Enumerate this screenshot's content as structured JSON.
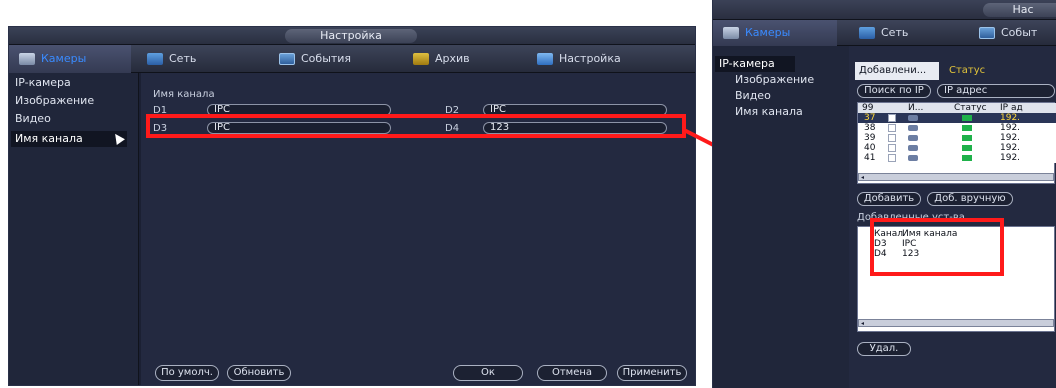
{
  "left": {
    "title": "Настройка",
    "menu": [
      {
        "label": "Камеры",
        "icon": "camera-icon"
      },
      {
        "label": "Сеть",
        "icon": "network-icon"
      },
      {
        "label": "События",
        "icon": "events-icon"
      },
      {
        "label": "Архив",
        "icon": "archive-icon"
      },
      {
        "label": "Настройка",
        "icon": "settings-icon"
      }
    ],
    "sidebar": [
      "IP-камера",
      "Изображение",
      "Видео",
      "Имя канала"
    ],
    "section_label": "Имя канала",
    "channels": [
      {
        "id": "D1",
        "name": "IPC"
      },
      {
        "id": "D2",
        "name": "IPC"
      },
      {
        "id": "D3",
        "name": "IPC"
      },
      {
        "id": "D4",
        "name": "123"
      }
    ],
    "buttons": {
      "default": "По умолч.",
      "refresh": "Обновить",
      "ok": "Ок",
      "cancel": "Отмена",
      "apply": "Применить"
    }
  },
  "right": {
    "title": "Нас",
    "menu": [
      {
        "label": "Камеры",
        "icon": "camera-icon"
      },
      {
        "label": "Сеть",
        "icon": "network-icon"
      },
      {
        "label": "Событ",
        "icon": "events-icon"
      }
    ],
    "sidebar": [
      "IP-камера",
      "Изображение",
      "Видео",
      "Имя канала"
    ],
    "tabs": [
      "Добавлени...",
      "Статус"
    ],
    "search_button": "Поиск по IP",
    "ip_filter": "IP адрес",
    "grid_headers": [
      "99",
      "И...",
      "Статус",
      "IP ад"
    ],
    "grid_rows": [
      {
        "n": "37",
        "ip": "192."
      },
      {
        "n": "38",
        "ip": "192."
      },
      {
        "n": "39",
        "ip": "192."
      },
      {
        "n": "40",
        "ip": "192."
      },
      {
        "n": "41",
        "ip": "192."
      }
    ],
    "add_button": "Добавить",
    "manual_button": "Доб. вручную",
    "added_label": "Добавленные уст-ва",
    "added_headers": [
      "Канал",
      "Имя канала"
    ],
    "added_rows": [
      {
        "ch": "D3",
        "name": "IPC"
      },
      {
        "ch": "D4",
        "name": "123"
      }
    ],
    "delete_button": "Удал.",
    "status_color": "#1fb24a",
    "highlight_color": "#ff1a1a"
  }
}
